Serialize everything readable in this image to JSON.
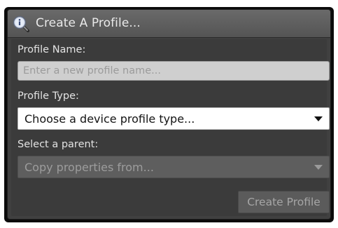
{
  "window": {
    "title": "Create A Profile...",
    "icon": "magnifier-info-icon"
  },
  "form": {
    "profile_name": {
      "label": "Profile Name:",
      "value": "",
      "placeholder": "Enter a new profile name..."
    },
    "profile_type": {
      "label": "Profile Type:",
      "selected": "Choose a device profile type..."
    },
    "parent": {
      "label": "Select a parent:",
      "selected": "Copy properties from...",
      "enabled": false
    },
    "submit_label": "Create Profile",
    "submit_enabled": false
  },
  "colors": {
    "panel": "#404040",
    "titlebar": "#5e5e5e",
    "input_bg": "#cfcfcf",
    "select_bg": "#ffffff",
    "disabled_bg": "#5e5e5e"
  }
}
